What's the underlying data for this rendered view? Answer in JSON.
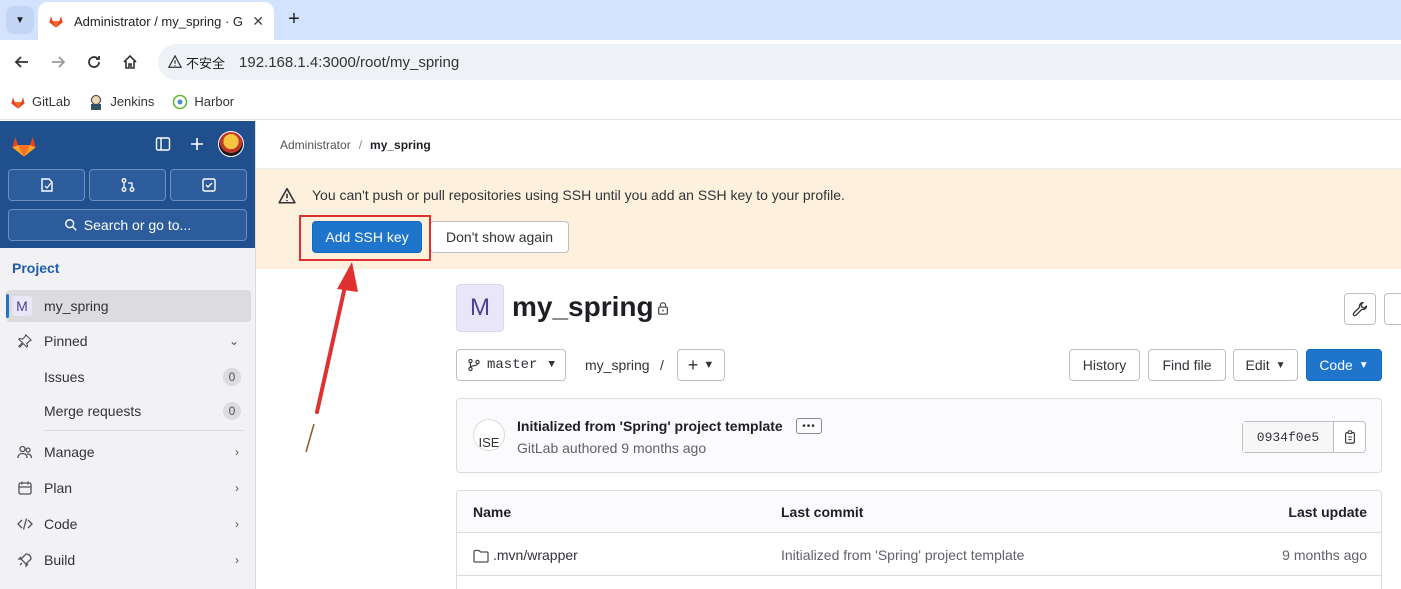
{
  "browser": {
    "tab_title": "Administrator / my_spring · G",
    "security_label": "不安全",
    "url": "192.168.1.4:3000/root/my_spring",
    "bookmarks": [
      {
        "label": "GitLab",
        "icon": "gitlab-icon"
      },
      {
        "label": "Jenkins",
        "icon": "jenkins-icon"
      },
      {
        "label": "Harbor",
        "icon": "harbor-icon"
      }
    ]
  },
  "sidebar": {
    "search_label": "Search or go to...",
    "section_title": "Project",
    "project_item": {
      "letter": "M",
      "label": "my_spring"
    },
    "pinned_label": "Pinned",
    "pinned_items": [
      {
        "label": "Issues",
        "count": "0"
      },
      {
        "label": "Merge requests",
        "count": "0"
      }
    ],
    "groups": [
      {
        "label": "Manage",
        "icon": "users-icon"
      },
      {
        "label": "Plan",
        "icon": "calendar-icon"
      },
      {
        "label": "Code",
        "icon": "code-icon"
      },
      {
        "label": "Build",
        "icon": "rocket-icon"
      }
    ]
  },
  "breadcrumb": {
    "parent": "Administrator",
    "separator": "/",
    "current": "my_spring"
  },
  "alert": {
    "message": "You can't push or pull repositories using SSH until you add an SSH key to your profile.",
    "primary_label": "Add SSH key",
    "secondary_label": "Don't show again"
  },
  "project": {
    "avatar_letter": "M",
    "name": "my_spring"
  },
  "repo_toolbar": {
    "branch": "master",
    "path": "my_spring",
    "path_separator": "/",
    "history_label": "History",
    "find_file_label": "Find file",
    "edit_label": "Edit",
    "code_label": "Code"
  },
  "last_commit": {
    "title": "Initialized from 'Spring' project template",
    "meta": "GitLab authored 9 months ago",
    "avatar_text": "ISE",
    "sha": "0934f0e5"
  },
  "file_table": {
    "headers": {
      "name": "Name",
      "last_commit": "Last commit",
      "last_update": "Last update"
    },
    "rows": [
      {
        "name": ".mvn/wrapper",
        "commit": "Initialized from 'Spring' project template",
        "updated": "9 months ago"
      }
    ]
  },
  "colors": {
    "sidebar_top": "#1f4f8c",
    "primary": "#1f75cb",
    "alert_bg": "#fdf1dd",
    "annotation_red": "#e03131"
  }
}
